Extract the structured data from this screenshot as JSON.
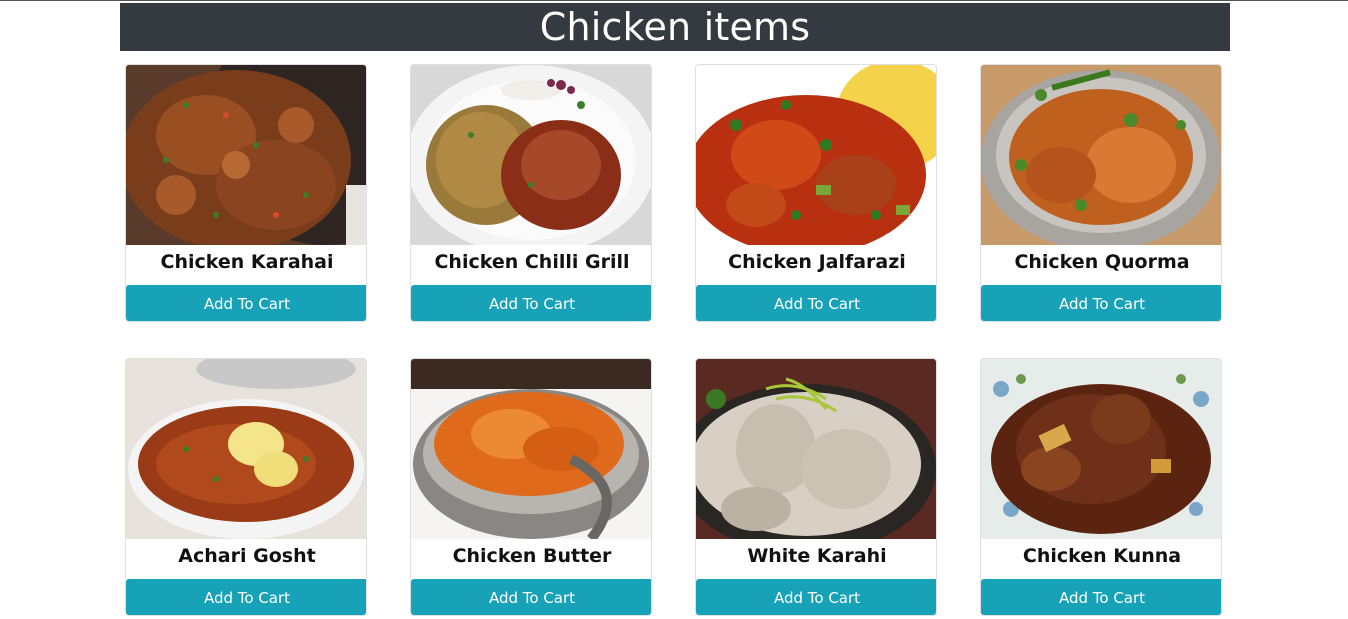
{
  "header": {
    "title": "Chicken items"
  },
  "items": [
    {
      "name": "Chicken Karahai",
      "button_label": "Add To Cart"
    },
    {
      "name": "Chicken Chilli Grill",
      "button_label": "Add To Cart"
    },
    {
      "name": "Chicken Jalfarazi",
      "button_label": "Add To Cart"
    },
    {
      "name": "Chicken Quorma",
      "button_label": "Add To Cart"
    },
    {
      "name": "Achari Gosht",
      "button_label": "Add To Cart"
    },
    {
      "name": "Chicken Butter",
      "button_label": "Add To Cart"
    },
    {
      "name": "White Karahi",
      "button_label": "Add To Cart"
    },
    {
      "name": "Chicken Kunna",
      "button_label": "Add To Cart"
    }
  ],
  "colors": {
    "header_bg": "#343a40",
    "button_bg": "#17a2b8"
  }
}
